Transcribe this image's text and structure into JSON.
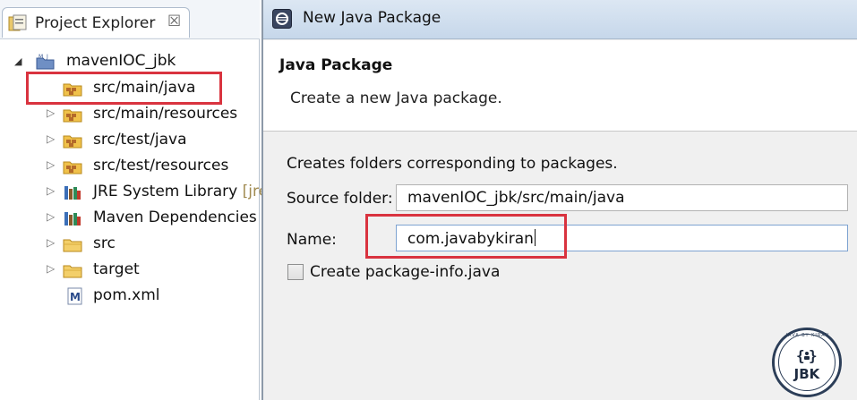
{
  "explorer": {
    "tab_label": "Project Explorer",
    "tab_close": "☒",
    "project": "mavenIOC_jbk",
    "items": [
      {
        "label": "src/main/java",
        "icon": "package-folder-icon",
        "highlighted": true
      },
      {
        "label": "src/main/resources",
        "icon": "package-folder-icon"
      },
      {
        "label": "src/test/java",
        "icon": "package-folder-icon"
      },
      {
        "label": "src/test/resources",
        "icon": "package-folder-icon"
      },
      {
        "label": "JRE System Library",
        "decoration": "[jre",
        "icon": "library-icon"
      },
      {
        "label": "Maven Dependencies",
        "icon": "library-icon"
      },
      {
        "label": "src",
        "icon": "folder-icon"
      },
      {
        "label": "target",
        "icon": "folder-icon"
      },
      {
        "label": "pom.xml",
        "icon": "maven-file-icon"
      }
    ]
  },
  "dialog": {
    "title": "New Java Package",
    "heading": "Java Package",
    "description": "Create a new Java package.",
    "info": "Creates folders corresponding to packages.",
    "source_folder_label": "Source folder:",
    "source_folder_value": "mavenIOC_jbk/src/main/java",
    "name_label": "Name:",
    "name_value": "com.javabykiran",
    "checkbox_label": "Create package-info.java",
    "checkbox_checked": false
  },
  "badge": {
    "arc_text": "JAVA BY KIRAN",
    "text": "JBK"
  },
  "colors": {
    "highlight": "#d9333f",
    "titlebar": "#c6d7ea",
    "dialog_bg": "#f0f0f0"
  }
}
